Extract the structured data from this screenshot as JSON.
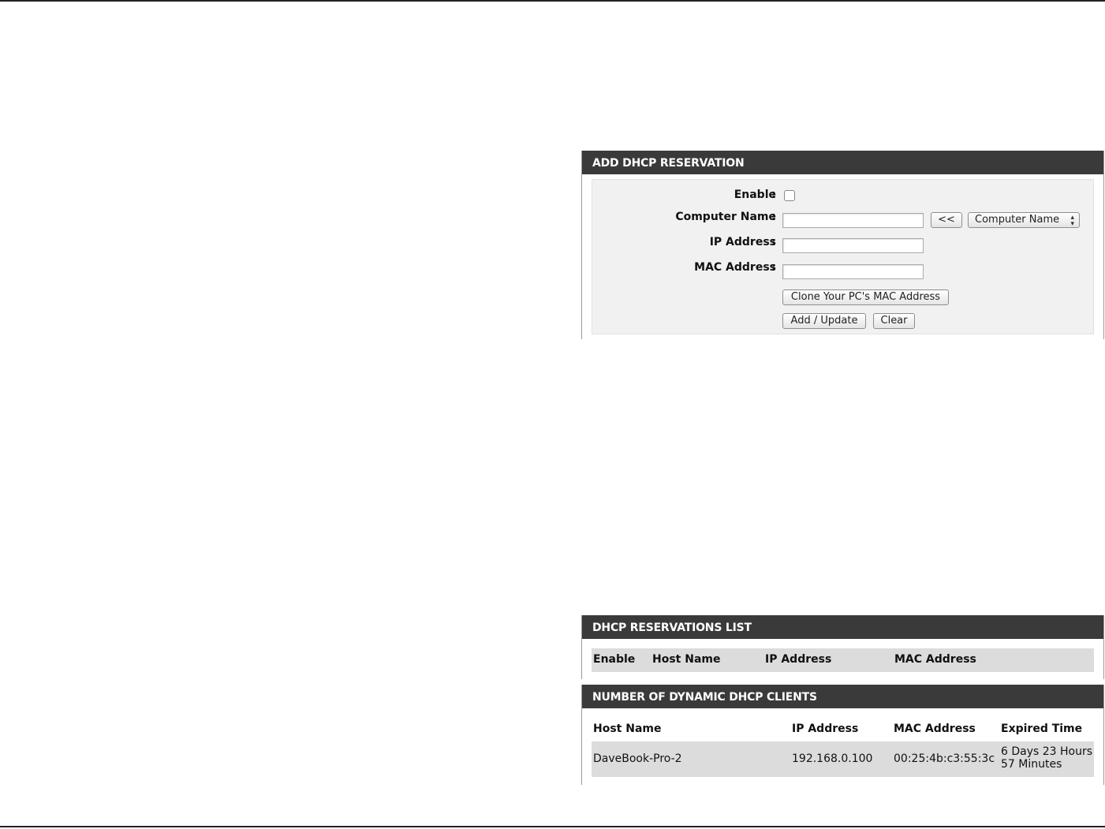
{
  "add_reservation": {
    "title": "ADD DHCP RESERVATION",
    "enable_label": "Enable",
    "computer_name_label": "Computer Name",
    "ip_address_label": "IP Address",
    "mac_address_label": "MAC Address",
    "colon": ":",
    "computer_name_value": "",
    "ip_address_value": "",
    "mac_address_value": "",
    "enable_checked": false,
    "copy_button": "<<",
    "computer_select_value": "Computer Name",
    "clone_mac_button": "Clone Your PC's MAC Address",
    "add_update_button": "Add / Update",
    "clear_button": "Clear"
  },
  "reservations_list": {
    "title": "DHCP RESERVATIONS LIST",
    "columns": [
      "Enable",
      "Host Name",
      "IP Address",
      "MAC Address"
    ],
    "rows": []
  },
  "dynamic_clients": {
    "title": "NUMBER OF DYNAMIC DHCP CLIENTS",
    "columns": [
      "Host Name",
      "IP Address",
      "MAC Address",
      "Expired Time"
    ],
    "rows": [
      {
        "host_name": "DaveBook-Pro-2",
        "ip_address": "192.168.0.100",
        "mac_address": "00:25:4b:c3:55:3c",
        "expired_line1": "6 Days 23 Hours",
        "expired_line2": "57 Minutes"
      }
    ]
  }
}
